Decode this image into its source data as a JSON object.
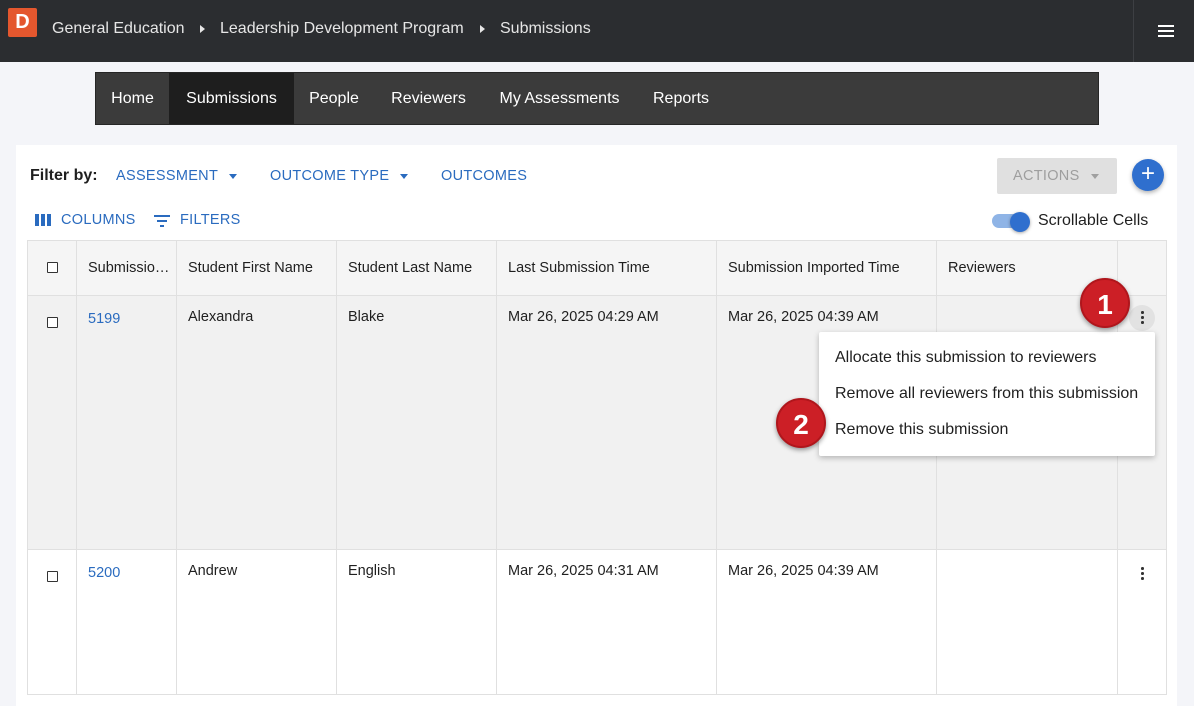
{
  "topbar": {
    "logo_letter": "D",
    "breadcrumbs": [
      "General Education",
      "Leadership Development Program",
      "Submissions"
    ]
  },
  "nav": {
    "items": [
      "Home",
      "Submissions",
      "People",
      "Reviewers",
      "My Assessments",
      "Reports"
    ],
    "active": "Submissions"
  },
  "filters": {
    "label": "Filter by:",
    "assessment": "ASSESSMENT",
    "outcome_type": "OUTCOME TYPE",
    "outcomes": "OUTCOMES",
    "actions": "ACTIONS",
    "add": "+"
  },
  "toolbar": {
    "columns": "COLUMNS",
    "filters": "FILTERS",
    "scrollable_cells": "Scrollable Cells",
    "scrollable_on": true
  },
  "table": {
    "headers": [
      "Submissio…",
      "Student First Name",
      "Student Last Name",
      "Last Submission Time",
      "Submission Imported Time",
      "Reviewers"
    ],
    "rows": [
      {
        "id": "5199",
        "first": "Alexandra",
        "last": "Blake",
        "last_submission": "Mar 26, 2025 04:29 AM",
        "imported": "Mar 26, 2025 04:39 AM",
        "reviewers": ""
      },
      {
        "id": "5200",
        "first": "Andrew",
        "last": "English",
        "last_submission": "Mar 26, 2025 04:31 AM",
        "imported": "Mar 26, 2025 04:39 AM",
        "reviewers": ""
      }
    ]
  },
  "row_menu": {
    "items": [
      "Allocate this submission to reviewers",
      "Remove all reviewers from this submission",
      "Remove this submission"
    ]
  },
  "callouts": [
    "1",
    "2"
  ],
  "colors": {
    "accent": "#2a6bbf",
    "topbar": "#2b2d30",
    "callout": "#cc1f26",
    "logo": "#e4572e"
  }
}
